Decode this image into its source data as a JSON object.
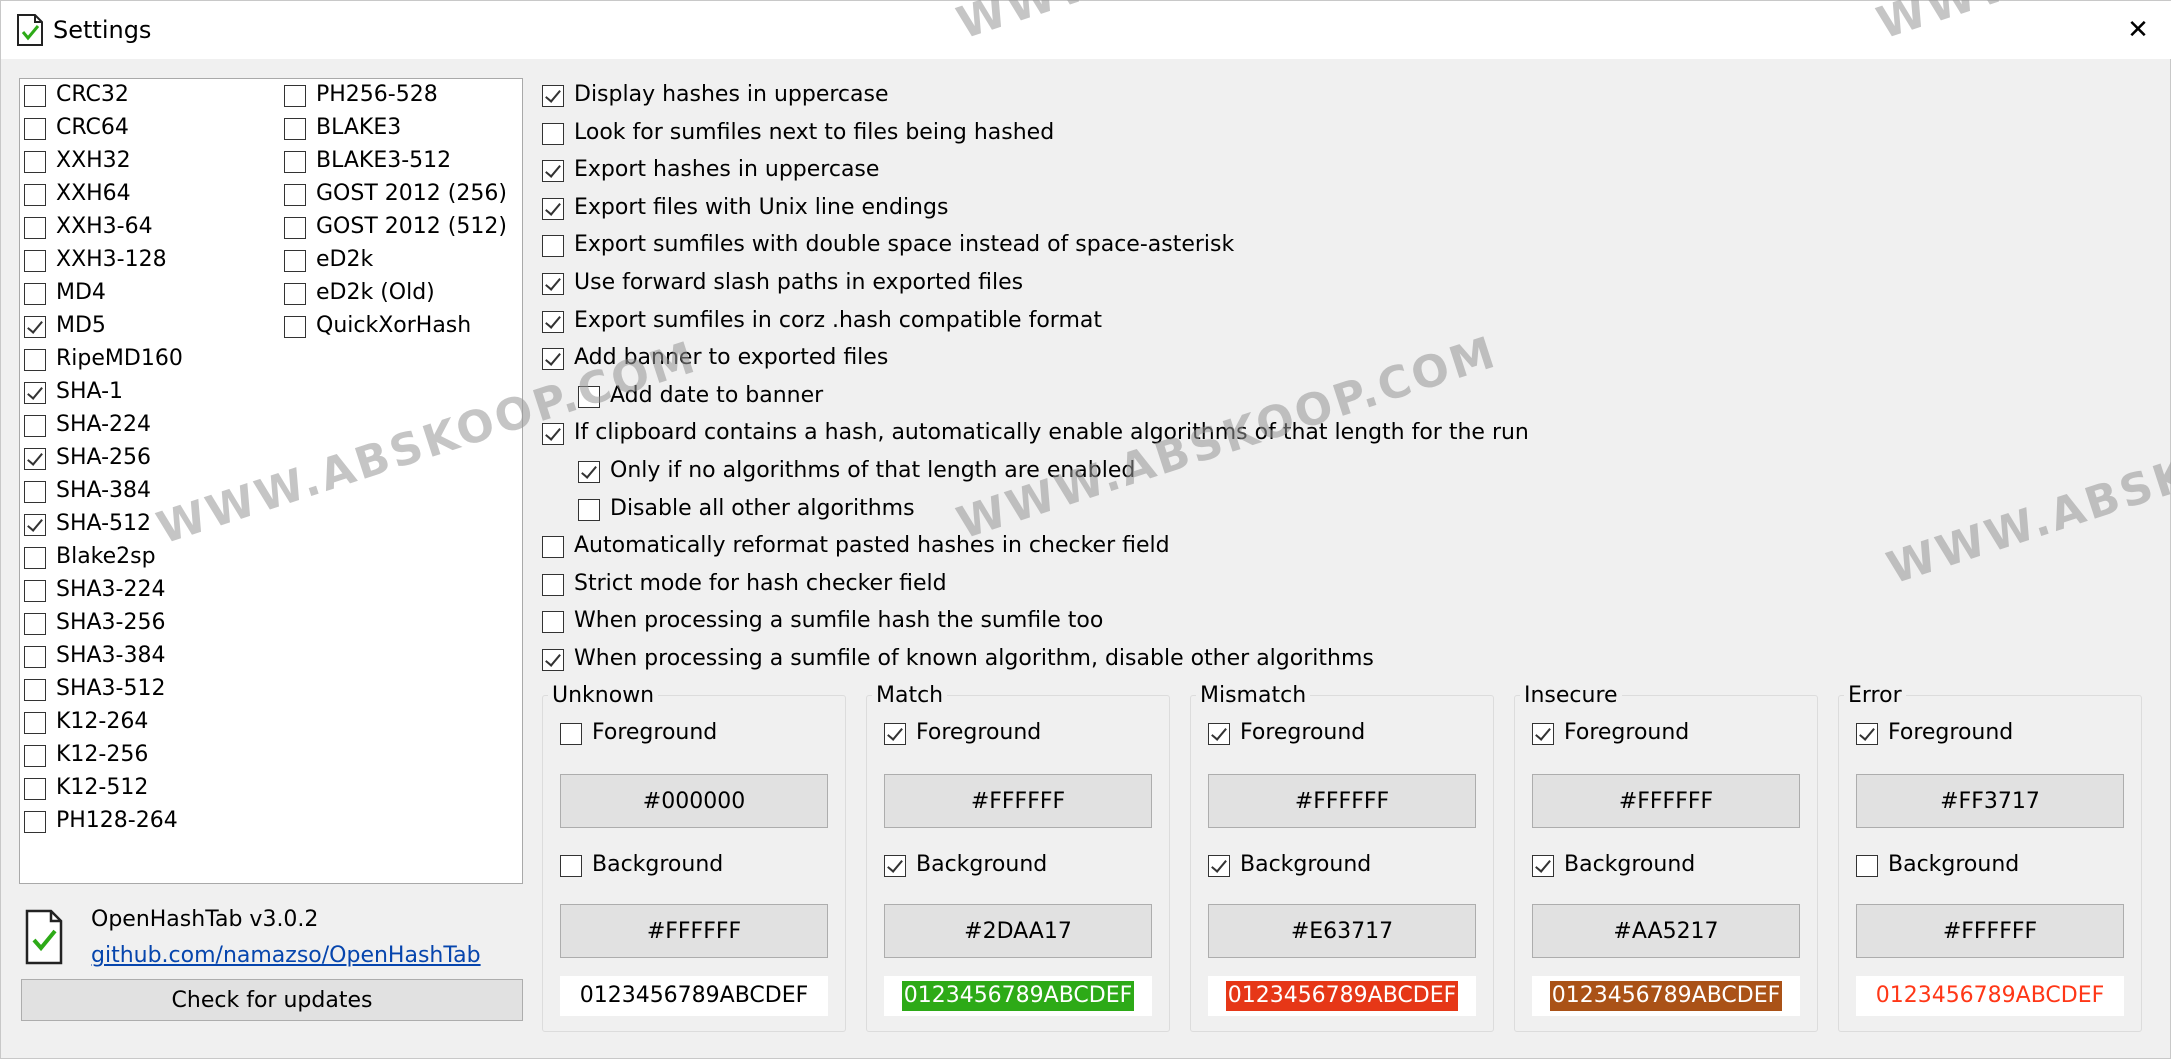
{
  "window": {
    "title": "Settings",
    "close_glyph": "✕"
  },
  "algorithms": {
    "col1": [
      {
        "label": "CRC32",
        "checked": false
      },
      {
        "label": "CRC64",
        "checked": false
      },
      {
        "label": "XXH32",
        "checked": false
      },
      {
        "label": "XXH64",
        "checked": false
      },
      {
        "label": "XXH3-64",
        "checked": false
      },
      {
        "label": "XXH3-128",
        "checked": false
      },
      {
        "label": "MD4",
        "checked": false
      },
      {
        "label": "MD5",
        "checked": true
      },
      {
        "label": "RipeMD160",
        "checked": false
      },
      {
        "label": "SHA-1",
        "checked": true
      },
      {
        "label": "SHA-224",
        "checked": false
      },
      {
        "label": "SHA-256",
        "checked": true
      },
      {
        "label": "SHA-384",
        "checked": false
      },
      {
        "label": "SHA-512",
        "checked": true
      },
      {
        "label": "Blake2sp",
        "checked": false
      },
      {
        "label": "SHA3-224",
        "checked": false
      },
      {
        "label": "SHA3-256",
        "checked": false
      },
      {
        "label": "SHA3-384",
        "checked": false
      },
      {
        "label": "SHA3-512",
        "checked": false
      },
      {
        "label": "K12-264",
        "checked": false
      },
      {
        "label": "K12-256",
        "checked": false
      },
      {
        "label": "K12-512",
        "checked": false
      },
      {
        "label": "PH128-264",
        "checked": false
      }
    ],
    "col2": [
      {
        "label": "PH256-528",
        "checked": false
      },
      {
        "label": "BLAKE3",
        "checked": false
      },
      {
        "label": "BLAKE3-512",
        "checked": false
      },
      {
        "label": "GOST 2012 (256)",
        "checked": false
      },
      {
        "label": "GOST 2012 (512)",
        "checked": false
      },
      {
        "label": "eD2k",
        "checked": false
      },
      {
        "label": "eD2k (Old)",
        "checked": false
      },
      {
        "label": "QuickXorHash",
        "checked": false
      }
    ]
  },
  "options": [
    {
      "label": "Display hashes in uppercase",
      "checked": true,
      "indent": 0
    },
    {
      "label": "Look for sumfiles next to files being hashed",
      "checked": false,
      "indent": 0
    },
    {
      "label": "Export hashes in uppercase",
      "checked": true,
      "indent": 0
    },
    {
      "label": "Export files with Unix line endings",
      "checked": true,
      "indent": 0
    },
    {
      "label": "Export sumfiles with double space instead of space-asterisk",
      "checked": false,
      "indent": 0
    },
    {
      "label": "Use forward slash paths in exported files",
      "checked": true,
      "indent": 0
    },
    {
      "label": "Export sumfiles in corz .hash compatible format",
      "checked": true,
      "indent": 0
    },
    {
      "label": "Add banner to exported files",
      "checked": true,
      "indent": 0
    },
    {
      "label": "Add date to banner",
      "checked": false,
      "indent": 1
    },
    {
      "label": "If clipboard contains a hash, automatically enable algorithms of that length for the run",
      "checked": true,
      "indent": 0
    },
    {
      "label": "Only if no algorithms of that length are enabled",
      "checked": true,
      "indent": 1
    },
    {
      "label": "Disable all other algorithms",
      "checked": false,
      "indent": 1
    },
    {
      "label": "Automatically reformat pasted hashes in checker field",
      "checked": false,
      "indent": 0
    },
    {
      "label": "Strict mode for hash checker field",
      "checked": false,
      "indent": 0
    },
    {
      "label": "When processing a sumfile hash the sumfile too",
      "checked": false,
      "indent": 0
    },
    {
      "label": "When processing a sumfile of known algorithm, disable other algorithms",
      "checked": true,
      "indent": 0
    }
  ],
  "color_groups": [
    {
      "title": "Unknown",
      "fg_label": "Foreground",
      "fg_checked": false,
      "fg_value": "#000000",
      "bg_label": "Background",
      "bg_checked": false,
      "bg_value": "#FFFFFF",
      "preview": "0123456789ABCDEF",
      "preview_fg": "#000000",
      "preview_bg": "#FFFFFF"
    },
    {
      "title": "Match",
      "fg_label": "Foreground",
      "fg_checked": true,
      "fg_value": "#FFFFFF",
      "bg_label": "Background",
      "bg_checked": true,
      "bg_value": "#2DAA17",
      "preview": "0123456789ABCDEF",
      "preview_fg": "#FFFFFF",
      "preview_bg": "#2DAA17"
    },
    {
      "title": "Mismatch",
      "fg_label": "Foreground",
      "fg_checked": true,
      "fg_value": "#FFFFFF",
      "bg_label": "Background",
      "bg_checked": true,
      "bg_value": "#E63717",
      "preview": "0123456789ABCDEF",
      "preview_fg": "#FFFFFF",
      "preview_bg": "#E63717"
    },
    {
      "title": "Insecure",
      "fg_label": "Foreground",
      "fg_checked": true,
      "fg_value": "#FFFFFF",
      "bg_label": "Background",
      "bg_checked": true,
      "bg_value": "#AA5217",
      "preview": "0123456789ABCDEF",
      "preview_fg": "#FFFFFF",
      "preview_bg": "#AA5217"
    },
    {
      "title": "Error",
      "fg_label": "Foreground",
      "fg_checked": true,
      "fg_value": "#FF3717",
      "bg_label": "Background",
      "bg_checked": false,
      "bg_value": "#FFFFFF",
      "preview": "0123456789ABCDEF",
      "preview_fg": "#FF3717",
      "preview_bg": "#FFFFFF"
    }
  ],
  "about": {
    "name": "OpenHashTab v3.0.2",
    "link": "github.com/namazso/OpenHashTab",
    "update_button": "Check for updates"
  },
  "watermark": "WWW.ABSKOOP.COM",
  "colors": {
    "check_green": "#2DAA17",
    "link": "#0645AD"
  }
}
